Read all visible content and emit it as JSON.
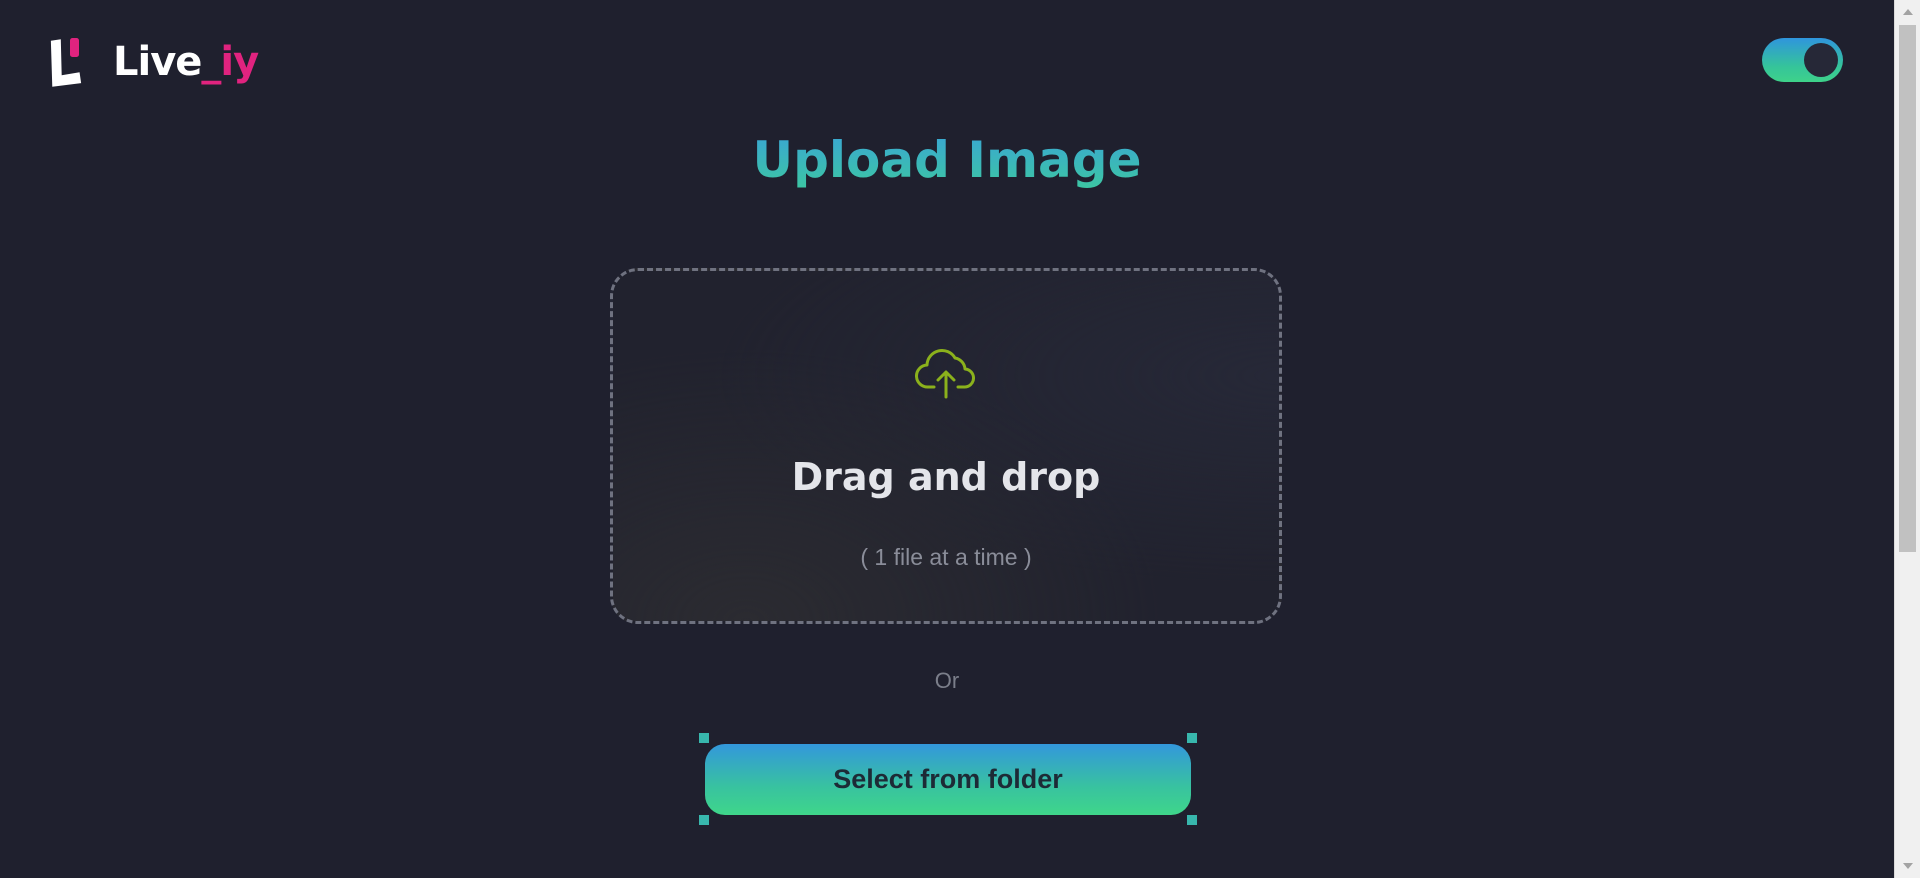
{
  "header": {
    "logo_text_main": "Live",
    "logo_text_accent": "_iy",
    "theme_toggle_state": "on"
  },
  "main": {
    "title": "Upload Image",
    "drop_zone": {
      "icon": "cloud-upload-icon",
      "title": "Drag and drop",
      "hint": "( 1 file at a time )"
    },
    "or_text": "Or",
    "select_button_label": "Select from folder"
  },
  "colors": {
    "background": "#1f202e",
    "brand_accent": "#e0237f",
    "gradient_top": "#3397dc",
    "gradient_bottom": "#3fd68a",
    "upload_icon": "#8bb11c"
  }
}
